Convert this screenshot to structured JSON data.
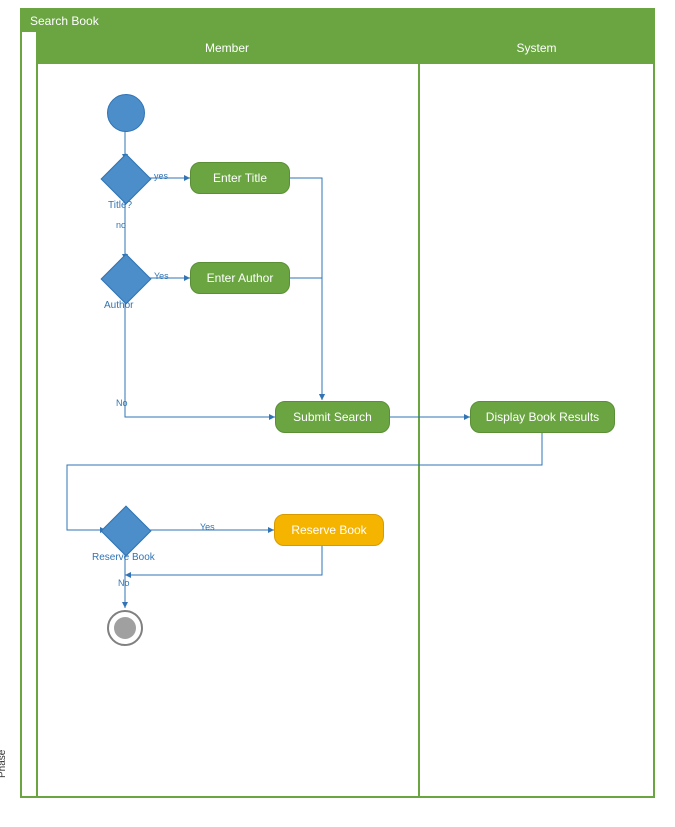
{
  "title": "Search Book",
  "phase_label": "Phase",
  "lanes": {
    "member": "Member",
    "system": "System"
  },
  "nodes": {
    "start": {
      "type": "initial"
    },
    "dec_title": {
      "label": "Title?"
    },
    "act_enter_title": {
      "label": "Enter Title"
    },
    "dec_author": {
      "label": "Author"
    },
    "act_enter_author": {
      "label": "Enter Author"
    },
    "act_submit": {
      "label": "Submit Search"
    },
    "act_display": {
      "label": "Display Book Results"
    },
    "dec_reserve": {
      "label": "Reserve Book"
    },
    "act_reserve": {
      "label": "Reserve Book"
    },
    "end": {
      "type": "final"
    }
  },
  "edges": {
    "title_yes": "yes",
    "title_no": "no",
    "author_yes": "Yes",
    "author_no": "No",
    "reserve_yes": "Yes",
    "reserve_no": "No"
  },
  "colors": {
    "frame": "#6aa542",
    "node_blue": "#4b8ec9",
    "action_green": "#6aa542",
    "action_orange": "#f5b400",
    "edge": "#3074b5"
  }
}
